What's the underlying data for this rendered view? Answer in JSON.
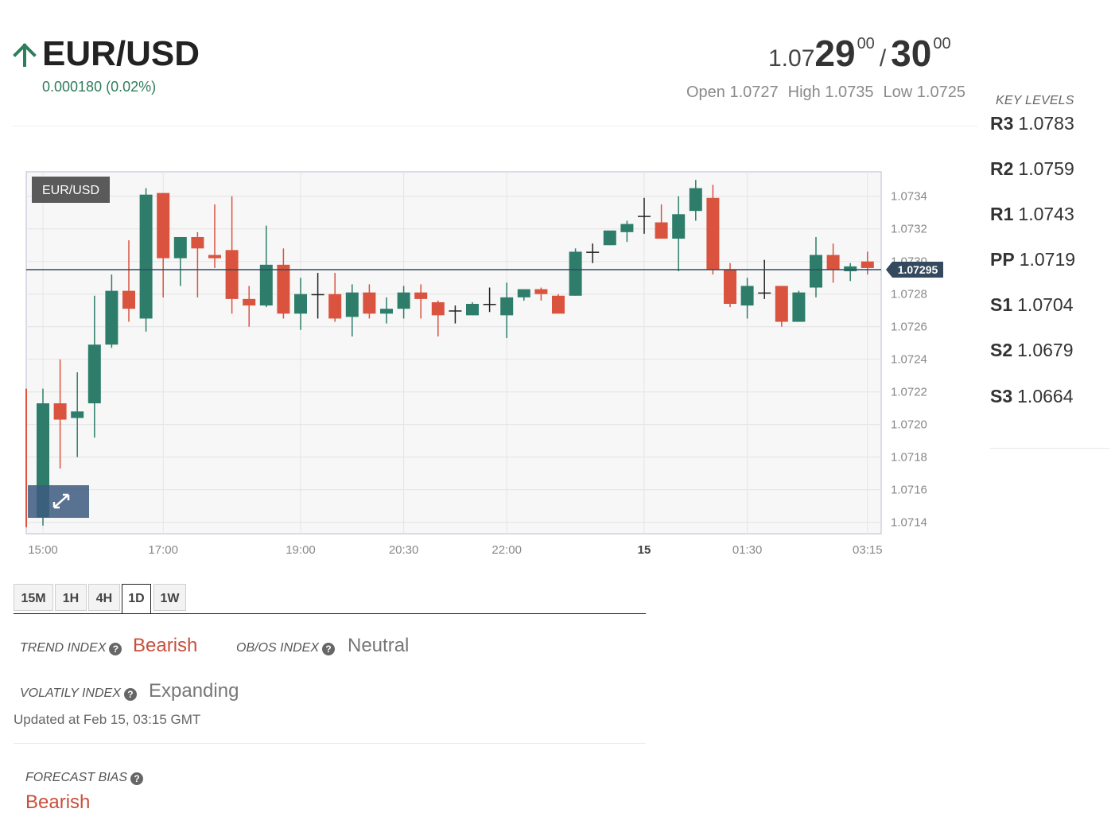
{
  "header": {
    "pair": "EUR/USD",
    "direction_icon": "arrow-up-icon",
    "change": "0.000180 (0.02%)",
    "bid": {
      "prefix": "1.07",
      "big": "29",
      "pipette": "00"
    },
    "separator": "/",
    "ask": {
      "big": "30",
      "pipette": "00"
    },
    "open": "Open 1.0727",
    "high": "High 1.0735",
    "low": "Low 1.0725"
  },
  "key_levels": {
    "title": "KEY LEVELS",
    "items": [
      {
        "name": "R3",
        "value": "1.0783"
      },
      {
        "name": "R2",
        "value": "1.0759"
      },
      {
        "name": "R1",
        "value": "1.0743"
      },
      {
        "name": "PP",
        "value": "1.0719"
      },
      {
        "name": "S1",
        "value": "1.0704"
      },
      {
        "name": "S2",
        "value": "1.0679"
      },
      {
        "name": "S3",
        "value": "1.0664"
      }
    ]
  },
  "timeframe_tabs": [
    "15M",
    "1H",
    "4H",
    "1D",
    "1W"
  ],
  "active_tab": "1D",
  "indicators": {
    "trend": {
      "label": "TREND INDEX",
      "value": "Bearish"
    },
    "obos": {
      "label": "OB/OS INDEX",
      "value": "Neutral"
    },
    "volatility": {
      "label": "VOLATILY INDEX",
      "value": "Expanding"
    },
    "updated": "Updated at Feb 15, 03:15 GMT",
    "forecast": {
      "label": "FORECAST BIAS",
      "value": "Bearish"
    }
  },
  "colors": {
    "up": "#2e7d6b",
    "down": "#d9533f",
    "price_line": "#34495e",
    "brand_green": "#2e7d5b",
    "bearish_text": "#c94f3d"
  },
  "chart_data": {
    "type": "candlestick",
    "legend": "EUR/USD",
    "current_price_label": "1.07295",
    "current_price": 1.07295,
    "y_ticks": [
      "1.0734",
      "1.0732",
      "1.0730",
      "1.0728",
      "1.0726",
      "1.0724",
      "1.0722",
      "1.0720",
      "1.0718",
      "1.0716",
      "1.0714"
    ],
    "ylim": [
      1.07133,
      1.07355
    ],
    "x_labels": [
      {
        "label": "15:00",
        "index": 0,
        "bold": false
      },
      {
        "label": "17:00",
        "index": 7,
        "bold": false
      },
      {
        "label": "19:00",
        "index": 15,
        "bold": false
      },
      {
        "label": "20:30",
        "index": 21,
        "bold": false
      },
      {
        "label": "22:00",
        "index": 27,
        "bold": false
      },
      {
        "label": "15",
        "index": 35,
        "bold": true
      },
      {
        "label": "01:30",
        "index": 41,
        "bold": false
      },
      {
        "label": "03:15",
        "index": 48,
        "bold": false
      }
    ],
    "candles": [
      {
        "o": 1.07143,
        "h": 1.07222,
        "l": 1.07138,
        "c": 1.07213
      },
      {
        "o": 1.07213,
        "h": 1.0724,
        "l": 1.07173,
        "c": 1.07203
      },
      {
        "o": 1.07204,
        "h": 1.07232,
        "l": 1.0718,
        "c": 1.07208
      },
      {
        "o": 1.07213,
        "h": 1.07279,
        "l": 1.07192,
        "c": 1.07249
      },
      {
        "o": 1.07249,
        "h": 1.07292,
        "l": 1.07247,
        "c": 1.07282
      },
      {
        "o": 1.07282,
        "h": 1.07313,
        "l": 1.07263,
        "c": 1.07271
      },
      {
        "o": 1.07265,
        "h": 1.07345,
        "l": 1.07257,
        "c": 1.07341
      },
      {
        "o": 1.07342,
        "h": 1.07342,
        "l": 1.07278,
        "c": 1.07302
      },
      {
        "o": 1.07302,
        "h": 1.07315,
        "l": 1.07285,
        "c": 1.07315
      },
      {
        "o": 1.07315,
        "h": 1.07318,
        "l": 1.07278,
        "c": 1.07308
      },
      {
        "o": 1.07304,
        "h": 1.07335,
        "l": 1.07296,
        "c": 1.07302
      },
      {
        "o": 1.07307,
        "h": 1.0734,
        "l": 1.07268,
        "c": 1.07277
      },
      {
        "o": 1.07277,
        "h": 1.07285,
        "l": 1.0726,
        "c": 1.07273
      },
      {
        "o": 1.07273,
        "h": 1.07322,
        "l": 1.07272,
        "c": 1.07298
      },
      {
        "o": 1.07298,
        "h": 1.07308,
        "l": 1.07265,
        "c": 1.07268
      },
      {
        "o": 1.07268,
        "h": 1.0729,
        "l": 1.07258,
        "c": 1.0728
      },
      {
        "o": 1.0728,
        "h": 1.07293,
        "l": 1.07265,
        "c": 1.0728
      },
      {
        "o": 1.0728,
        "h": 1.07293,
        "l": 1.07263,
        "c": 1.07265
      },
      {
        "o": 1.07266,
        "h": 1.07286,
        "l": 1.07254,
        "c": 1.07281
      },
      {
        "o": 1.07281,
        "h": 1.07286,
        "l": 1.07265,
        "c": 1.07268
      },
      {
        "o": 1.07268,
        "h": 1.07278,
        "l": 1.07262,
        "c": 1.07271
      },
      {
        "o": 1.07271,
        "h": 1.07285,
        "l": 1.07265,
        "c": 1.07281
      },
      {
        "o": 1.07281,
        "h": 1.07286,
        "l": 1.07265,
        "c": 1.07277
      },
      {
        "o": 1.07275,
        "h": 1.07276,
        "l": 1.07254,
        "c": 1.07267
      },
      {
        "o": 1.0727,
        "h": 1.07273,
        "l": 1.07262,
        "c": 1.0727
      },
      {
        "o": 1.07267,
        "h": 1.07275,
        "l": 1.07267,
        "c": 1.07274
      },
      {
        "o": 1.07274,
        "h": 1.07284,
        "l": 1.07269,
        "c": 1.07274
      },
      {
        "o": 1.07267,
        "h": 1.07287,
        "l": 1.07253,
        "c": 1.07278
      },
      {
        "o": 1.07278,
        "h": 1.07283,
        "l": 1.07276,
        "c": 1.07283
      },
      {
        "o": 1.07283,
        "h": 1.07284,
        "l": 1.07276,
        "c": 1.0728
      },
      {
        "o": 1.07279,
        "h": 1.0728,
        "l": 1.07268,
        "c": 1.07268
      },
      {
        "o": 1.07279,
        "h": 1.07308,
        "l": 1.07279,
        "c": 1.07306
      },
      {
        "o": 1.07306,
        "h": 1.07311,
        "l": 1.07299,
        "c": 1.07306
      },
      {
        "o": 1.0731,
        "h": 1.07317,
        "l": 1.0731,
        "c": 1.07319
      },
      {
        "o": 1.07318,
        "h": 1.07325,
        "l": 1.07312,
        "c": 1.07323
      },
      {
        "o": 1.07328,
        "h": 1.07339,
        "l": 1.07317,
        "c": 1.07328
      },
      {
        "o": 1.07324,
        "h": 1.07335,
        "l": 1.07314,
        "c": 1.07314
      },
      {
        "o": 1.07314,
        "h": 1.0734,
        "l": 1.07294,
        "c": 1.07329
      },
      {
        "o": 1.07331,
        "h": 1.0735,
        "l": 1.07325,
        "c": 1.07345
      },
      {
        "o": 1.07339,
        "h": 1.07347,
        "l": 1.07292,
        "c": 1.07295
      },
      {
        "o": 1.07295,
        "h": 1.07299,
        "l": 1.07272,
        "c": 1.07274
      },
      {
        "o": 1.07273,
        "h": 1.0729,
        "l": 1.07265,
        "c": 1.07285
      },
      {
        "o": 1.07281,
        "h": 1.07301,
        "l": 1.07277,
        "c": 1.07281
      },
      {
        "o": 1.07285,
        "h": 1.07285,
        "l": 1.0726,
        "c": 1.07263
      },
      {
        "o": 1.07263,
        "h": 1.07282,
        "l": 1.07263,
        "c": 1.07281
      },
      {
        "o": 1.07284,
        "h": 1.07315,
        "l": 1.07278,
        "c": 1.07304
      },
      {
        "o": 1.07304,
        "h": 1.07311,
        "l": 1.07287,
        "c": 1.07295
      },
      {
        "o": 1.07294,
        "h": 1.07299,
        "l": 1.07288,
        "c": 1.07297
      },
      {
        "o": 1.073,
        "h": 1.07306,
        "l": 1.07292,
        "c": 1.07296
      }
    ]
  }
}
